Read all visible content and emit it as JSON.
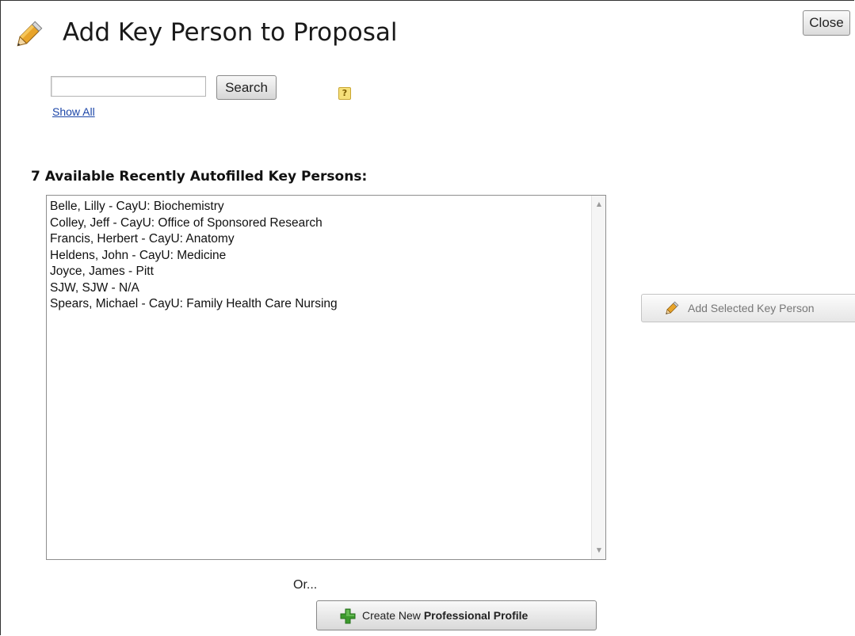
{
  "dialog": {
    "title": "Add Key Person to Proposal",
    "close_label": "Close"
  },
  "search": {
    "value": "",
    "placeholder": "",
    "button_label": "Search",
    "help_glyph": "?",
    "show_all_label": "Show All"
  },
  "list": {
    "heading": "7 Available Recently Autofilled Key Persons:",
    "items": [
      "Belle, Lilly - CayU: Biochemistry",
      "Colley, Jeff - CayU: Office of Sponsored Research",
      "Francis, Herbert - CayU: Anatomy",
      "Heldens, John - CayU: Medicine",
      "Joyce, James - Pitt",
      "SJW, SJW - N/A",
      "Spears, Michael - CayU: Family Health Care Nursing"
    ]
  },
  "actions": {
    "add_selected_label": "Add Selected Key Person",
    "or_text": "Or...",
    "create_label_prefix": "Create New ",
    "create_label_bold": "Professional Profile"
  },
  "icons": {
    "title": "pencil-icon",
    "add_selected": "pencil-icon",
    "create": "green-plus-icon",
    "help": "help-icon"
  },
  "colors": {
    "link": "#1c46a8",
    "help_badge": "#f6e07a",
    "plus_green": "#3c9a2d"
  }
}
